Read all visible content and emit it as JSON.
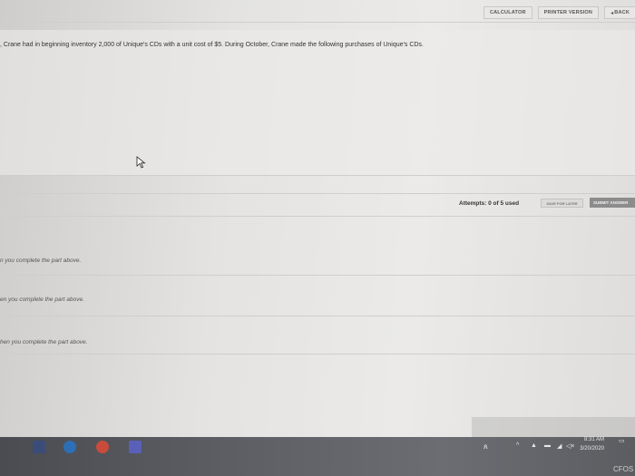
{
  "toolbar": {
    "calculator": "CALCULATOR",
    "printer_version": "PRINTER VERSION",
    "back": "BACK"
  },
  "question": {
    "text": ", Crane had in beginning inventory 2,000 of Unique's CDs with a unit cost of $5. During October, Crane made the following purchases of Unique's CDs."
  },
  "attempts": {
    "label": "Attempts: 0 of 5 used",
    "save_later": "SAVE FOR LATER",
    "submit": "SUBMIT ANSWER"
  },
  "parts": [
    {
      "note": "n you complete the part above."
    },
    {
      "note": "en you complete the part above."
    },
    {
      "note": "hen you complete the part above."
    }
  ],
  "taskbar": {
    "time": "8:31 AM",
    "date": "3/20/2020",
    "partial_text": "CFOS"
  }
}
